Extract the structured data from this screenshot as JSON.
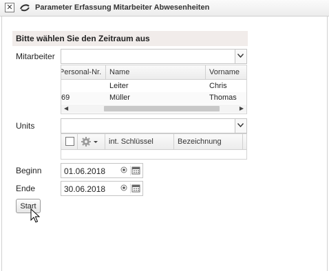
{
  "window": {
    "title": "Parameter Erfassung Mitarbeiter Abwesenheiten",
    "close_glyph": "✕"
  },
  "section": {
    "heading": "Bitte wählen Sie den Zeitraum aus"
  },
  "mitarbeiter": {
    "label": "Mitarbeiter",
    "value": "",
    "columns": [
      "Personal-Nr.",
      "Name",
      "Vorname"
    ],
    "rows": [
      {
        "nr": "",
        "name": "Leiter",
        "vorname": "Chris"
      },
      {
        "nr": "69",
        "name": "Müller",
        "vorname": "Thomas"
      }
    ]
  },
  "units": {
    "label": "Units",
    "value": "",
    "columns": [
      "int. Schlüssel",
      "Bezeichnung"
    ]
  },
  "beginn": {
    "label": "Beginn",
    "value": "01.06.2018"
  },
  "ende": {
    "label": "Ende",
    "value": "30.06.2018"
  },
  "actions": {
    "start_label": "Start"
  },
  "icons": {
    "close": "close-icon",
    "app": "app-logo-icon",
    "dropdown": "chevron-down-icon",
    "settings": "gear-icon",
    "calendar": "calendar-icon",
    "clear": "clear-icon"
  }
}
